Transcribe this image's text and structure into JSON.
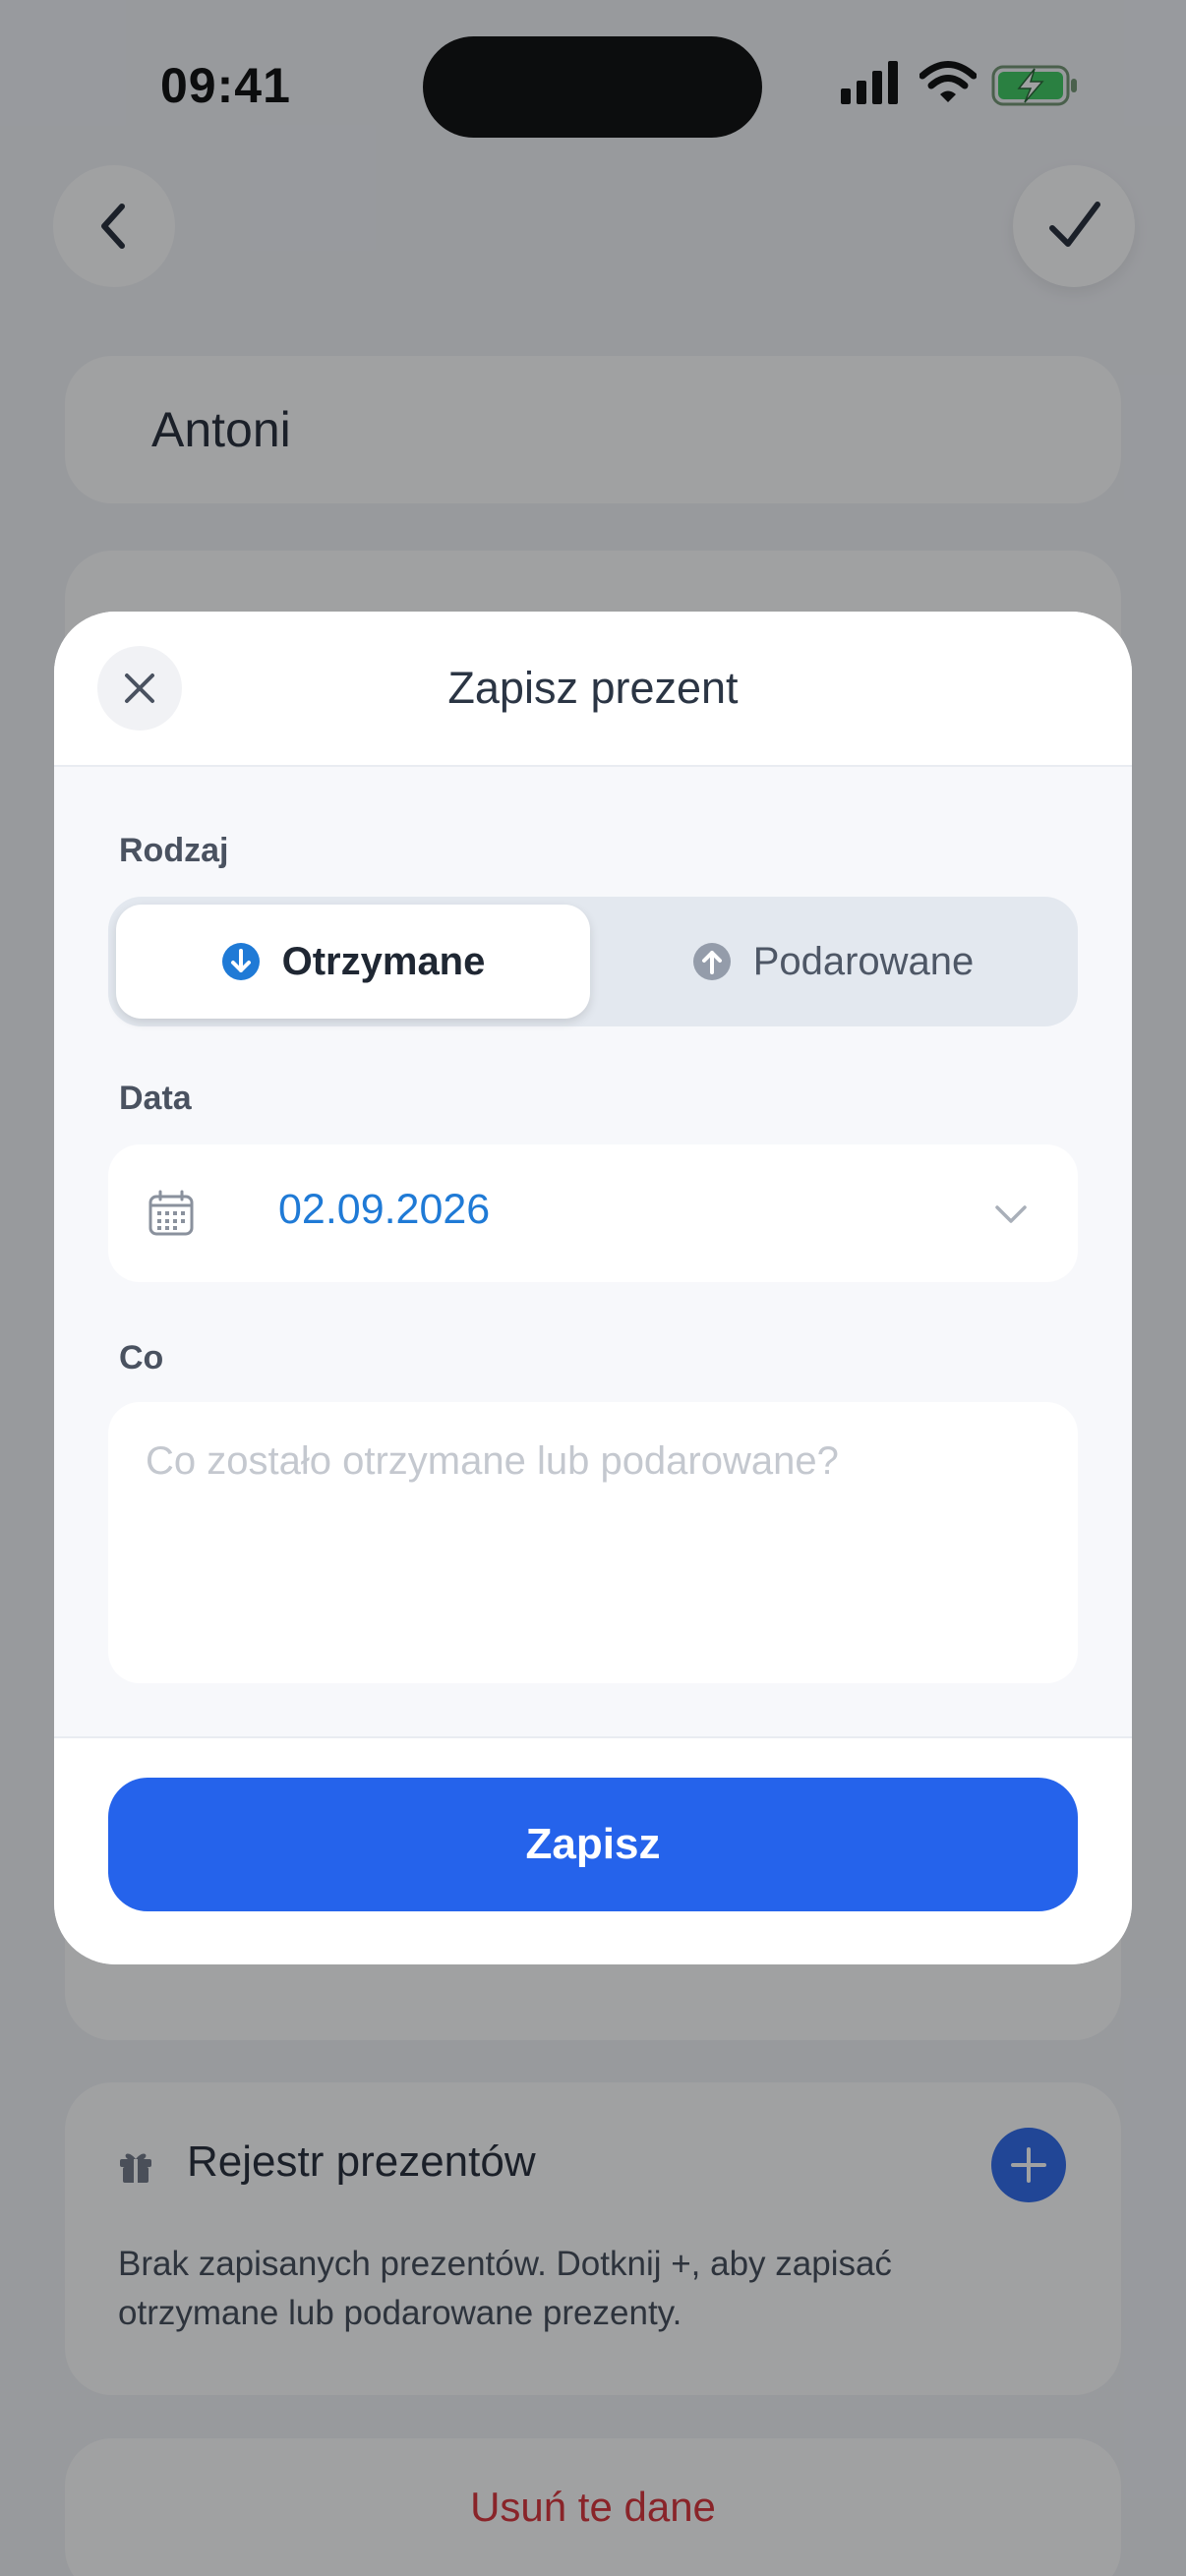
{
  "status_bar": {
    "time": "09:41"
  },
  "form": {
    "name": "Antoni"
  },
  "gift_registry": {
    "title": "Rejestr prezentów",
    "empty_message": "Brak zapisanych prezentów. Dotknij +, aby zapisać otrzymane lub podarowane prezenty."
  },
  "delete_label": "Usuń te dane",
  "sheet": {
    "title": "Zapisz prezent",
    "type_label": "Rodzaj",
    "type_options": [
      {
        "label": "Otrzymane",
        "selected": true,
        "icon": "arrow-down-circle-icon"
      },
      {
        "label": "Podarowane",
        "selected": false,
        "icon": "arrow-up-circle-icon"
      }
    ],
    "date_label": "Data",
    "date_value": "02.09.2026",
    "what_label": "Co",
    "what_placeholder": "Co zostało otrzymane lub podarowane?",
    "what_value": "",
    "save_label": "Zapisz"
  },
  "colors": {
    "accent": "#2563eb",
    "date_text": "#1f7ad6",
    "danger": "#d8282f",
    "battery_green": "#34c759"
  }
}
